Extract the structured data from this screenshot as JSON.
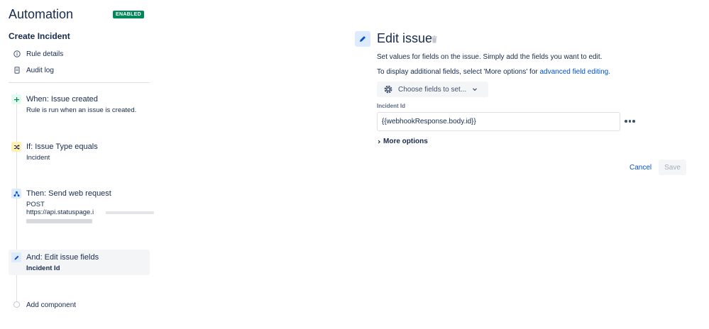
{
  "sidebar": {
    "app_title": "Automation",
    "status_badge": "ENABLED",
    "rule_name": "Create Incident",
    "nav": [
      {
        "label": "Rule details",
        "icon": "info-icon"
      },
      {
        "label": "Audit log",
        "icon": "document-icon"
      }
    ],
    "components": [
      {
        "title": "When: Issue created",
        "subtitle": "Rule is run when an issue is created.",
        "icon": "trigger-plus-icon",
        "icon_color": "#e3fcef"
      },
      {
        "title": "If: Issue Type equals",
        "subtitle": "Incident",
        "icon": "condition-shuffle-icon",
        "icon_color": "#fff0b3"
      },
      {
        "title": "Then: Send web request",
        "subtitle": "POST",
        "url": "https://api.statuspage.i",
        "icon": "webhook-icon",
        "icon_color": "#deebff"
      },
      {
        "title": "And: Edit issue fields",
        "subtitle": "Incident Id",
        "icon": "pencil-icon",
        "icon_color": "#deebff"
      }
    ],
    "add_component": "Add component"
  },
  "panel": {
    "title": "Edit issue",
    "description_1": "Set values for fields on the issue. Simply add the fields you want to edit.",
    "description_2_prefix": "To display additional fields, select 'More options' for ",
    "description_2_link": "advanced field editing.",
    "choose_fields_label": "Choose fields to set...",
    "field_label": "Incident Id",
    "field_value": "{{webhookResponse.body.id}}",
    "more_options": "More options",
    "cancel_label": "Cancel",
    "save_label": "Save"
  },
  "colors": {
    "accent": "#0052cc",
    "badge_green": "#00875a",
    "text": "#172b4d"
  }
}
